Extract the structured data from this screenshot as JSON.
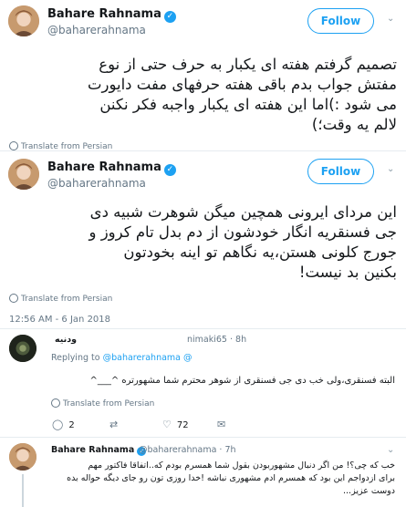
{
  "tweet1": {
    "name": "Bahare Rahnama",
    "handle": "@baharerahnama",
    "follow_label": "Follow",
    "text_lines": [
      "تصمیم گرفتم هفته ای یکبار به حرف حتی از نوع",
      "مفتش جواب بدم باقی هفته حرفهای مفت دایورت",
      "می شود :)اما این هفته ای یکبار واجبه فکر نکنن",
      "لالم یه وقت؛)"
    ],
    "translate_label": "Translate from Persian"
  },
  "tweet2": {
    "name": "Bahare Rahnama",
    "handle": "@baharerahnama",
    "follow_label": "Follow",
    "text_lines": [
      "این مردای ایرونی همچین میگن شوهرت شبیه دی",
      "جی فسنقریه انگار خودشون از دم بدل تام کروز و",
      "جورج کلونی هستن،یه نگاهم تو اینه بخودتون",
      "بکنین بد نیست!"
    ],
    "translate_label": "Translate from Persian",
    "timestamp": "12:56 AM - 6 Jan 2018"
  },
  "reply1": {
    "name": "ودنیه",
    "handle_partial": "nimaki65 · 8h",
    "replying_prefix": "Replying to",
    "replying_mention": "@baharerahnama",
    "replying_suffix": "@",
    "text_line1": "البته فسنقری،ولی خب دی جی فسنقری از شوهر محترم شما مشهورتره ^___^",
    "translate_label": "Translate from Persian",
    "replies_count": "2",
    "likes_count": "72"
  },
  "reply2": {
    "name": "Bahare Rahnama",
    "handle_time": "@baharerahnama · 7h",
    "text_lines": [
      "خب که چی؟! من اگر دنبال مشهوربودن بقول شما همسرم بودم که..اتفاقا فاکتور مهم",
      "برای ازدواجم این بود که همسرم ادم مشهوری نباشه !خدا روزی تون رو جای دیگه حواله بده",
      "دوست عزیز..."
    ]
  },
  "icons": {
    "verified": "verified-badge-icon",
    "chevron": "chevron-down-icon",
    "globe": "globe-icon",
    "reply": "reply-icon",
    "retweet": "retweet-icon",
    "like": "heart-icon"
  },
  "colors": {
    "accent": "#1da1f2",
    "secondary_text": "#657786",
    "divider": "#e6ecf0"
  }
}
